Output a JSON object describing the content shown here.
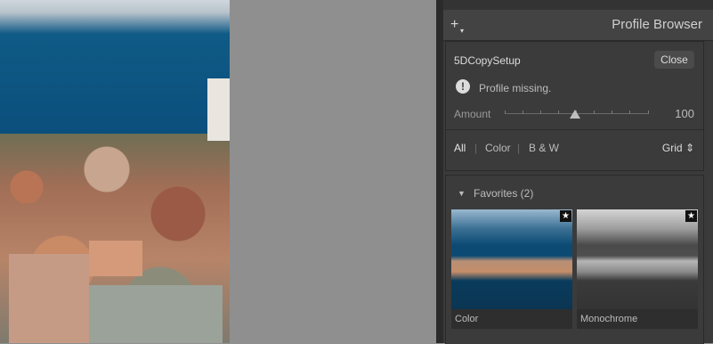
{
  "panel": {
    "title": "Profile Browser",
    "add_icon": "plus-icon"
  },
  "profile": {
    "name": "5DCopySetup",
    "close_label": "Close",
    "warning_icon": "exclamation-icon",
    "warning_text": "Profile missing.",
    "amount_label": "Amount",
    "amount_value": "100",
    "amount_fraction": 0.5
  },
  "filters": {
    "items": [
      "All",
      "Color",
      "B & W"
    ],
    "view_label": "Grid",
    "view_icon": "updown-chevron-icon"
  },
  "favorites": {
    "label": "Favorites (2)",
    "profiles": [
      {
        "name": "Color",
        "starred": true
      },
      {
        "name": "Monochrome",
        "starred": true
      }
    ]
  }
}
